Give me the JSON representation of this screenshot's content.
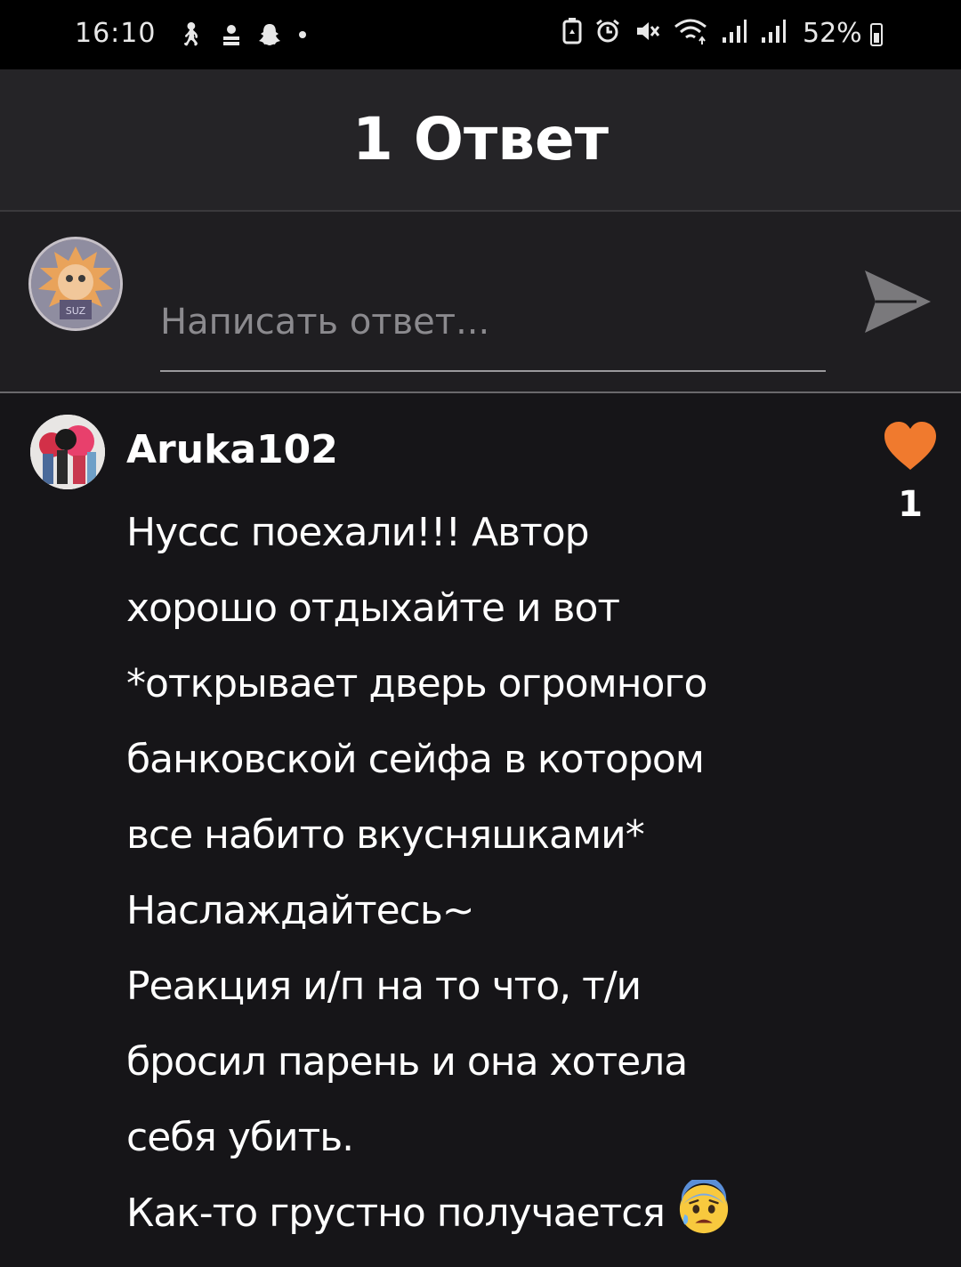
{
  "status_bar": {
    "time": "16:10",
    "battery": "52%",
    "left_icons": [
      "walking-icon",
      "person-icon",
      "snapchat-icon",
      "dot-icon"
    ],
    "right_icons": [
      "battery-saver-icon",
      "alarm-icon",
      "mute-icon",
      "wifi-icon",
      "signal-icon",
      "signal-icon"
    ]
  },
  "header": {
    "title": "1 Ответ"
  },
  "composer": {
    "placeholder": "Написать ответ..."
  },
  "comment": {
    "username": "Aruka102",
    "lines": [
      "Нуссс поехали!!! Автор",
      "хорошо отдыхайте и вот",
      "*открывает дверь огромного",
      "банковской сейфа в котором",
      "все набито вкусняшками*",
      "Наслаждайтесь~",
      "Реакция и/п на то что, т/и",
      "бросил парень и она хотела",
      "себя убить.",
      "Как-то грустно получается"
    ],
    "emoji": "anxious-face-with-sweat",
    "likes": "1"
  },
  "colors": {
    "background": "#161518",
    "header_bg": "#252427",
    "like_heart": "#f07a2e"
  }
}
